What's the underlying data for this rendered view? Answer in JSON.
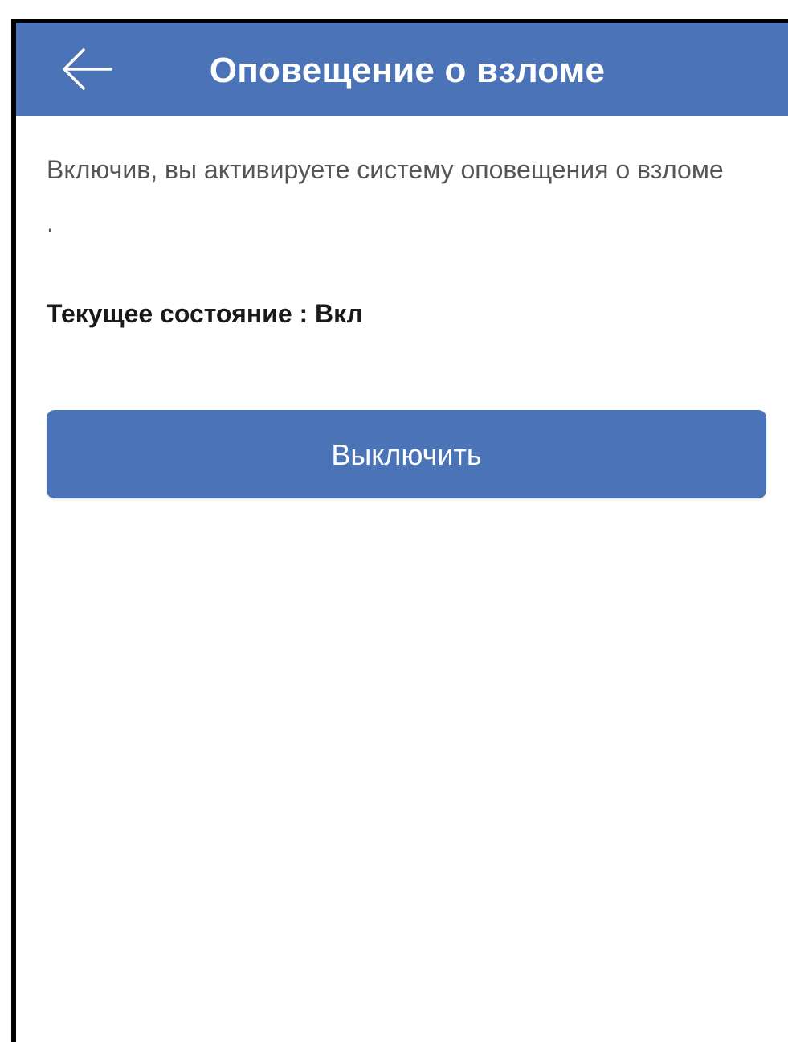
{
  "theme": {
    "accent": "#4a73b8"
  },
  "header": {
    "back_icon": "arrow-left-icon",
    "title": "Оповещение о взломе"
  },
  "main": {
    "description": "Включив, вы активируете систему оповещения о взломе .",
    "status_text": "Текущее состояние : Вкл",
    "toggle_button_label": "Выключить"
  }
}
